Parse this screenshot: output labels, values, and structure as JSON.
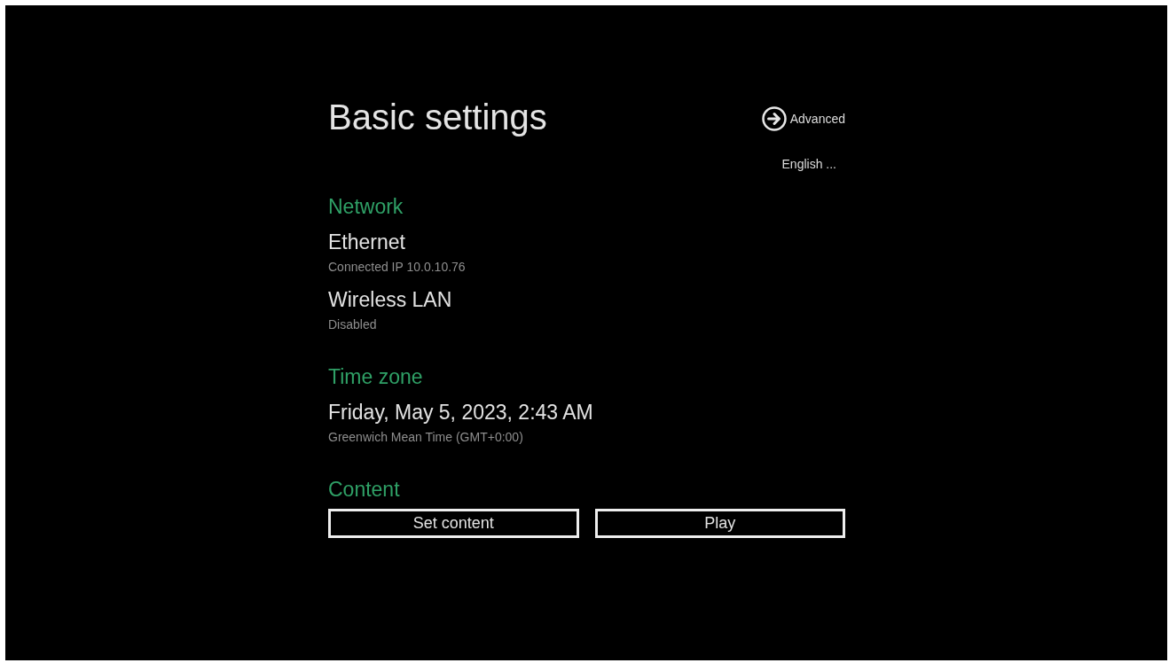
{
  "title": "Basic settings",
  "advanced_link": {
    "label": "Advanced"
  },
  "language": {
    "label": "English ..."
  },
  "sections": [
    {
      "heading": "Network",
      "items": [
        {
          "name": "Ethernet",
          "detail": "Connected IP 10.0.10.76"
        },
        {
          "name": "Wireless LAN",
          "detail": "Disabled"
        }
      ]
    },
    {
      "heading": "Time zone",
      "items": [
        {
          "name": "Friday, May 5, 2023, 2:43 AM",
          "detail": "Greenwich Mean Time (GMT+0:00)"
        }
      ]
    },
    {
      "heading": "Content",
      "buttons": [
        {
          "label": "Set content"
        },
        {
          "label": "Play"
        }
      ]
    }
  ]
}
